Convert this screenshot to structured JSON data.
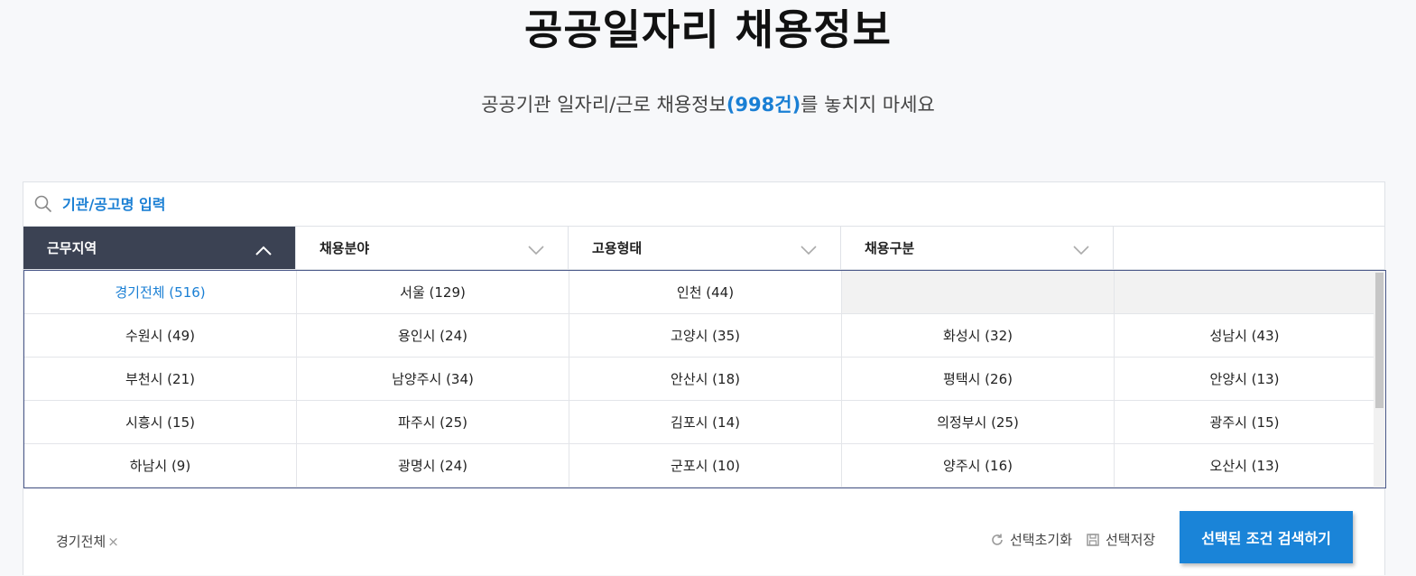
{
  "header": {
    "title": "공공일자리 채용정보",
    "subtitle_before": "공공기관 일자리/근로 채용정보",
    "subtitle_count": "(998건)",
    "subtitle_after": "를 놓치지 마세요"
  },
  "search": {
    "placeholder": "기관/공고명 입력"
  },
  "tabs": [
    {
      "label": "근무지역",
      "active": true
    },
    {
      "label": "채용분야"
    },
    {
      "label": "고용형태"
    },
    {
      "label": "채용구분"
    }
  ],
  "regions": [
    "경기전체 (516)",
    "서울 (129)",
    "인천 (44)",
    "",
    "",
    "수원시 (49)",
    "용인시 (24)",
    "고양시 (35)",
    "화성시 (32)",
    "성남시 (43)",
    "부천시 (21)",
    "남양주시 (34)",
    "안산시 (18)",
    "평택시 (26)",
    "안양시 (13)",
    "시흥시 (15)",
    "파주시 (25)",
    "김포시 (14)",
    "의정부시 (25)",
    "광주시 (15)",
    "하남시 (9)",
    "광명시 (24)",
    "군포시 (10)",
    "양주시 (16)",
    "오산시 (13)"
  ],
  "selected_chip": {
    "label": "경기전체",
    "remove": "×"
  },
  "actions": {
    "reset_label": "선택초기화",
    "save_label": "선택저장",
    "search_label": "선택된 조건 검색하기"
  },
  "colors": {
    "accent": "#1a7fd4",
    "active_tab": "#3b4253"
  }
}
